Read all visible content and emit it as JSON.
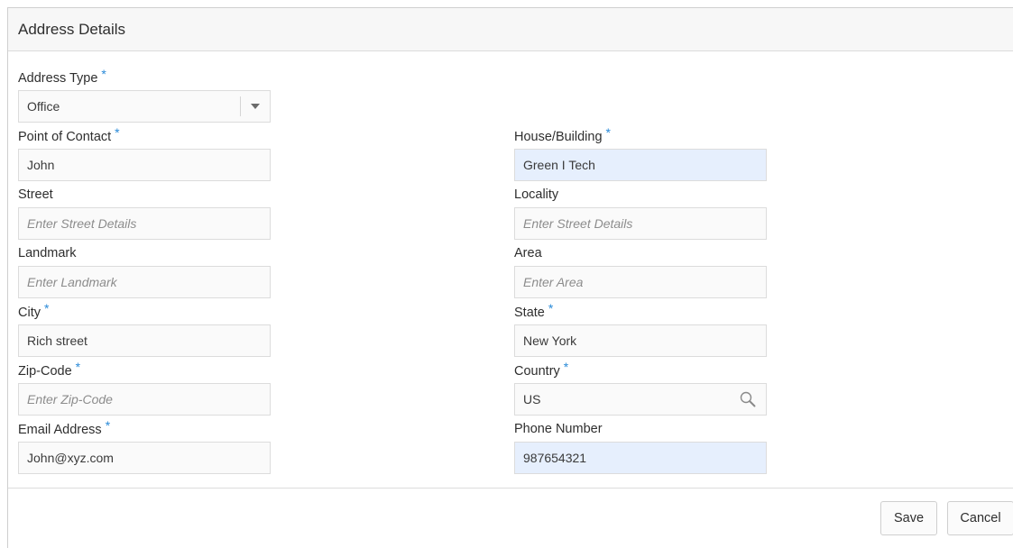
{
  "dialog": {
    "title": "Address Details"
  },
  "required_marker": "*",
  "fields": {
    "address_type": {
      "label": "Address Type",
      "value": "Office",
      "required": true
    },
    "point_of_contact": {
      "label": "Point of Contact",
      "value": "John",
      "required": true
    },
    "house_building": {
      "label": "House/Building",
      "value": "Green I Tech",
      "required": true
    },
    "street": {
      "label": "Street",
      "placeholder": "Enter Street Details"
    },
    "locality": {
      "label": "Locality",
      "placeholder": "Enter Street Details"
    },
    "landmark": {
      "label": "Landmark",
      "placeholder": "Enter Landmark"
    },
    "area": {
      "label": "Area",
      "placeholder": "Enter Area"
    },
    "city": {
      "label": "City",
      "value": "Rich street",
      "required": true
    },
    "state": {
      "label": "State",
      "value": "New York",
      "required": true
    },
    "zip_code": {
      "label": "Zip-Code",
      "placeholder": "Enter Zip-Code",
      "required": true
    },
    "country": {
      "label": "Country",
      "value": "US",
      "required": true,
      "icon": "search-icon"
    },
    "email_address": {
      "label": "Email Address",
      "value": "John@xyz.com",
      "required": true
    },
    "phone_number": {
      "label": "Phone Number",
      "value": "987654321"
    }
  },
  "footer": {
    "save_label": "Save",
    "cancel_label": "Cancel"
  },
  "colors": {
    "required_marker": "#2a8ad8",
    "highlight_field": "#e6effd",
    "header_bg": "#f7f7f7"
  }
}
